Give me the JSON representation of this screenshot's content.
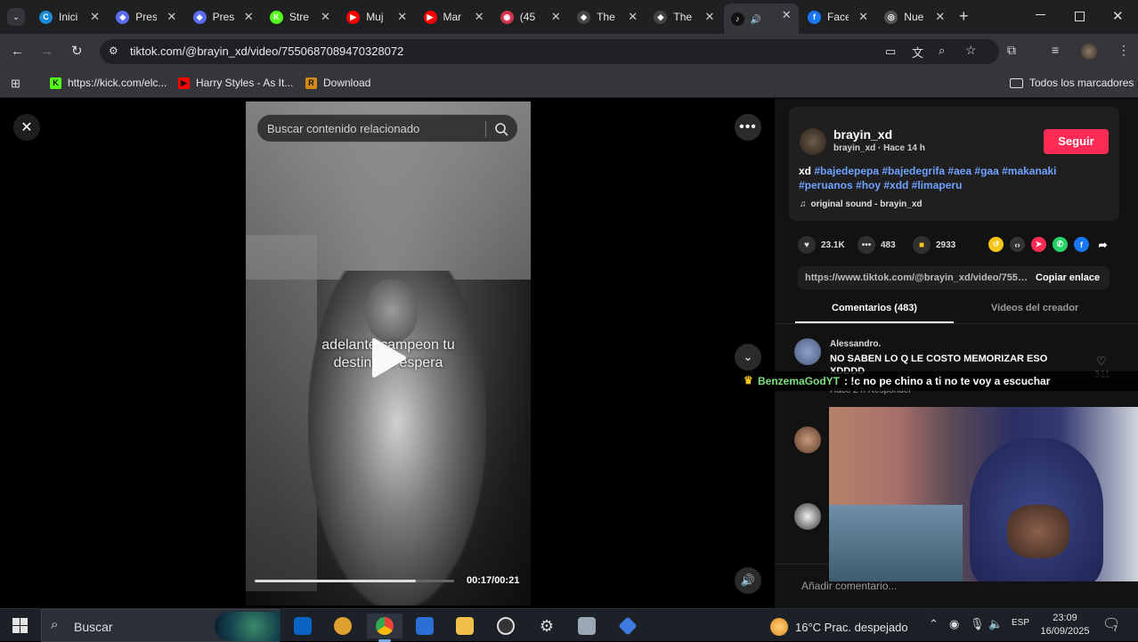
{
  "colors": {
    "accent": "#fe2c55",
    "hashtag": "#6fa2ff",
    "chat_user": "#7ee081"
  },
  "tabs": [
    {
      "label": "Inici",
      "icon": "edge-icon",
      "color": "#1d8ad6",
      "glyph": "C"
    },
    {
      "label": "Pres",
      "icon": "shield-icon",
      "color": "#5b6cf0",
      "glyph": "◈"
    },
    {
      "label": "Pres",
      "icon": "shield-icon",
      "color": "#5b6cf0",
      "glyph": "◈"
    },
    {
      "label": "Stre",
      "icon": "kick-icon",
      "color": "#53fc18",
      "glyph": "K"
    },
    {
      "label": "Muj",
      "icon": "youtube-icon",
      "color": "#ff0000",
      "glyph": "▶"
    },
    {
      "label": "Mar",
      "icon": "youtube-icon",
      "color": "#ff0000",
      "glyph": "▶"
    },
    {
      "label": "(45",
      "icon": "discord-icon",
      "color": "#d0344a",
      "glyph": "◉"
    },
    {
      "label": "The",
      "icon": "diamond-icon",
      "color": "#444",
      "glyph": "◆"
    },
    {
      "label": "The",
      "icon": "diamond-icon",
      "color": "#444",
      "glyph": "◆"
    },
    {
      "label": "",
      "icon": "tiktok-icon",
      "color": "#111",
      "glyph": "♪"
    },
    {
      "label": "Face",
      "icon": "facebook-icon",
      "color": "#1877f2",
      "glyph": "f"
    },
    {
      "label": "Nue",
      "icon": "chrome-icon",
      "color": "#555",
      "glyph": "◎"
    }
  ],
  "toolbar": {
    "url": "tiktok.com/@brayin_xd/video/7550687089470328072"
  },
  "bookmarks": {
    "items": [
      {
        "label": "https://kick.com/elc...",
        "color": "#53fc18",
        "glyph": "K"
      },
      {
        "label": "Harry Styles - As It...",
        "color": "#ff0000",
        "glyph": "▶"
      },
      {
        "label": "Download",
        "color": "#d28a17",
        "glyph": "R"
      }
    ],
    "all_label": "Todos los marcadores"
  },
  "video": {
    "search_placeholder": "Buscar contenido relacionado",
    "caption_line1": "adelante campeon tu",
    "caption_line2": "destino te espera",
    "timecode": "00:17/00:21",
    "progress": 0.81
  },
  "post": {
    "username": "brayin_xd",
    "sub": "brayin_xd · Hace 14 h",
    "follow": "Seguir",
    "desc_prefix": "xd ",
    "hashtags_line1": "#bajedepepa #bajedegrifa #aea #gaa #makanaki",
    "hashtags_line2": "#peruanos #hoy #xdd #limaperu",
    "sound": "original sound - brayin_xd",
    "likes": "23.1K",
    "comments": "483",
    "saves": "2933",
    "link": "https://www.tiktok.com/@brayin_xd/video/75506...",
    "copy_link": "Copiar enlace",
    "tab_comments": "Comentarios (483)",
    "tab_creator": "Videos del creador"
  },
  "comment1": {
    "user": "Alessandro.",
    "text": "NO SABEN LO Q LE COSTO MEMORIZAR ESO XDDDD",
    "meta": "Hace 2 h     Responder",
    "likes": "311"
  },
  "add_comment_placeholder": "Añadir comentario...",
  "chat": {
    "user": "BenzemaGodYT",
    "message": ": !c no pe chino a ti no te voy a escuchar"
  },
  "taskbar": {
    "search": "Buscar",
    "weather": "16°C  Prac. despejado",
    "lang": "ESP",
    "time": "23:09",
    "date": "16/09/2025",
    "notifications": "7"
  }
}
